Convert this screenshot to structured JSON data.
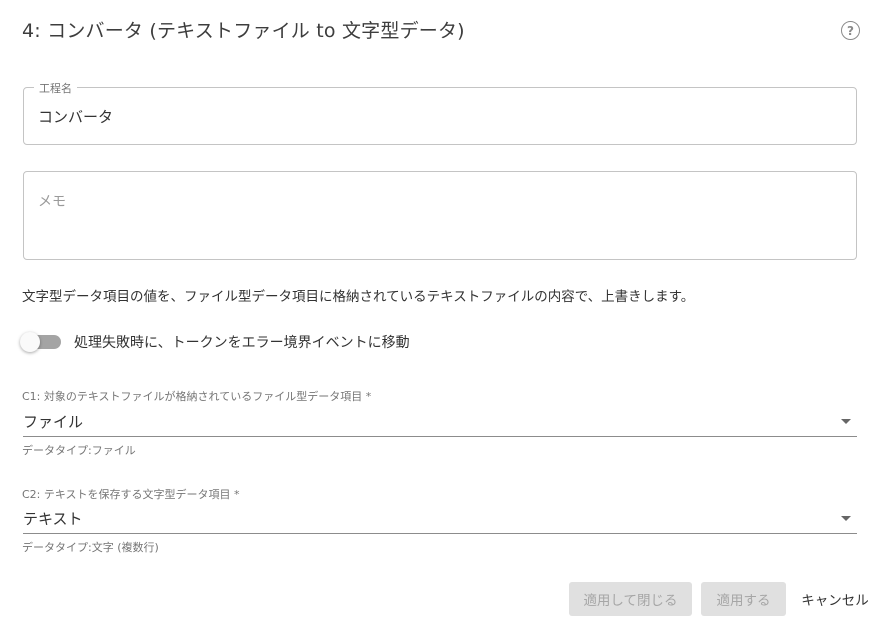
{
  "dialog": {
    "title": "4: コンバータ (テキストファイル to 文字型データ)",
    "help_icon": "help-circle-icon"
  },
  "form": {
    "name_field": {
      "label": "工程名",
      "value": "コンバータ"
    },
    "memo_field": {
      "placeholder": "メモ",
      "value": ""
    },
    "description": "文字型データ項目の値を、ファイル型データ項目に格納されているテキストファイルの内容で、上書きします。",
    "error_toggle": {
      "label": "処理失敗時に、トークンをエラー境界イベントに移動",
      "checked": false
    },
    "c1": {
      "label": "C1: 対象のテキストファイルが格納されているファイル型データ項目 *",
      "selected": "ファイル",
      "helper": "データタイプ:ファイル"
    },
    "c2": {
      "label": "C2: テキストを保存する文字型データ項目 *",
      "selected": "テキスト",
      "helper": "データタイプ:文字 (複数行)"
    }
  },
  "actions": {
    "apply_close_label": "適用して閉じる",
    "apply_label": "適用する",
    "cancel_label": "キャンセル"
  },
  "colors": {
    "text": "#333333",
    "muted": "#757575",
    "border": "#c4c4c4",
    "disabled_bg": "#e0e0e0",
    "disabled_text": "#a6a6a6",
    "toggle_track": "#a4a4a4"
  }
}
